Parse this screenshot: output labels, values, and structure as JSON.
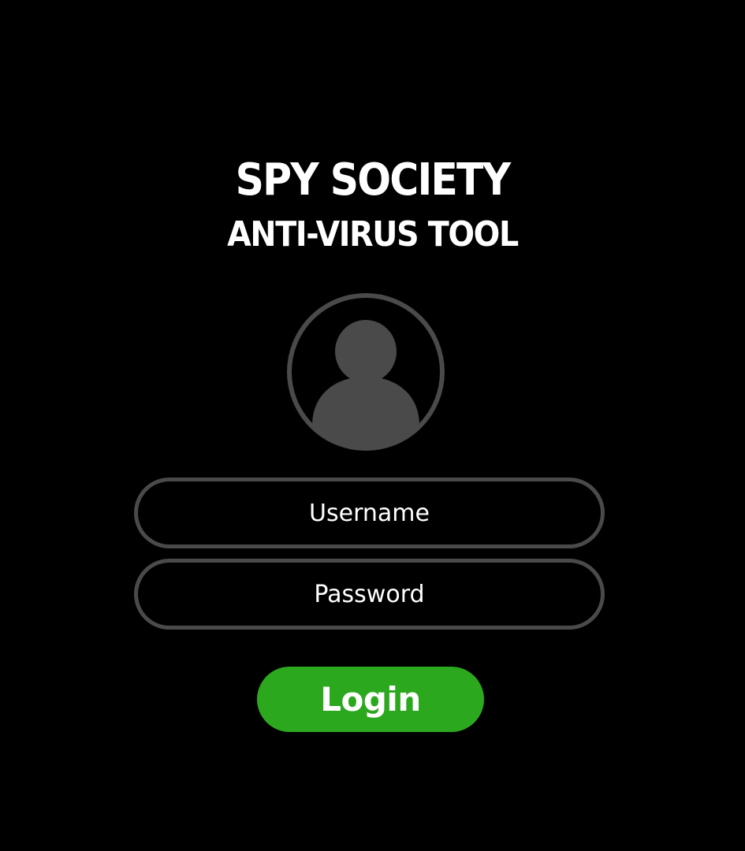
{
  "header": {
    "title": "SPY SOCIETY",
    "subtitle": "ANTI-VIRUS TOOL"
  },
  "avatar": {
    "icon": "user-icon",
    "color": "#4a4a4a"
  },
  "form": {
    "username_placeholder": "Username",
    "password_placeholder": "Password",
    "login_label": "Login"
  },
  "colors": {
    "background": "#000000",
    "field_border": "#4a4a4a",
    "login_button": "#2ba81e",
    "text": "#ffffff"
  }
}
